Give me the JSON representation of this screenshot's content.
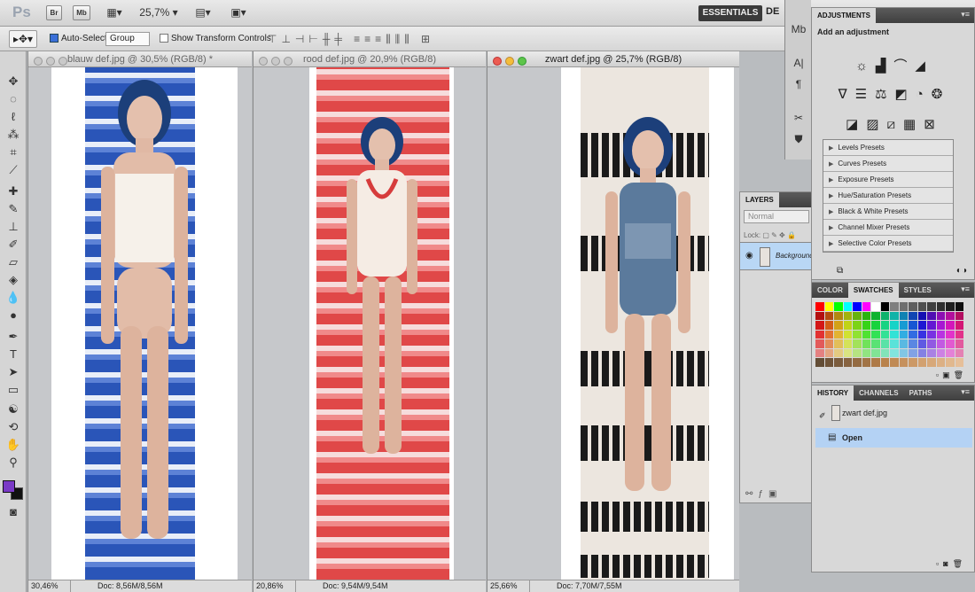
{
  "app": {
    "logo": "Ps",
    "bridge": "Br",
    "mini_bridge": "Mb",
    "zoom": "25,7%",
    "workspace": "ESSENTIALS",
    "workspace_next": "DE"
  },
  "options": {
    "auto_select_label": "Auto-Select:",
    "auto_select_value": "Group",
    "show_transform_label": "Show Transform Controls",
    "tool_icon": "move-arrow-icon"
  },
  "documents": [
    {
      "title": "blauw def.jpg @ 30,5% (RGB/8) *",
      "zoom": "30,46%",
      "doc": "Doc: 8,56M/8,56M",
      "print_color": "#2a55b8",
      "active": false
    },
    {
      "title": "rood  def.jpg @ 20,9% (RGB/8)",
      "zoom": "20,86%",
      "doc": "Doc: 9,54M/9,54M",
      "print_color": "#e04848",
      "active": false
    },
    {
      "title": "zwart def.jpg @ 25,7% (RGB/8)",
      "zoom": "25,66%",
      "doc": "Doc: 7,70M/7,55M",
      "print_color": "#1a1a1a",
      "active": true
    }
  ],
  "adjustments": {
    "tab": "ADJUSTMENTS",
    "subtitle": "Add an adjustment",
    "presets": [
      "Levels Presets",
      "Curves Presets",
      "Exposure Presets",
      "Hue/Saturation Presets",
      "Black & White Presets",
      "Channel Mixer Presets",
      "Selective Color Presets"
    ]
  },
  "layers": {
    "tab": "LAYERS",
    "blend": "Normal",
    "lock_label": "Lock:",
    "layer_name": "Background"
  },
  "color_panel": {
    "tabs": [
      "COLOR",
      "SWATCHES",
      "STYLES"
    ],
    "active": "SWATCHES"
  },
  "history_panel": {
    "tabs": [
      "HISTORY",
      "CHANNELS",
      "PATHS"
    ],
    "snapshot": "zwart def.jpg",
    "state": "Open"
  },
  "colors": {
    "foreground": "#7a3ac6",
    "background": "#111111"
  }
}
